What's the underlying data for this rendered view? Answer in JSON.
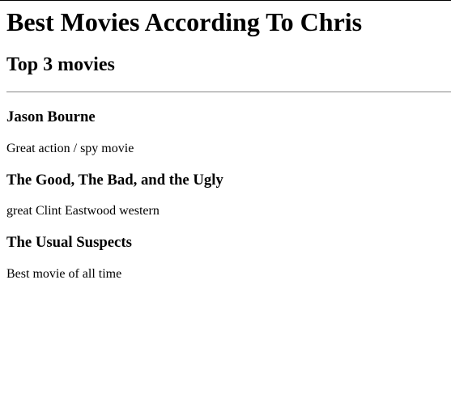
{
  "header": {
    "title": "Best Movies According To Chris",
    "subtitle": "Top 3 movies"
  },
  "movies": [
    {
      "title": "Jason Bourne",
      "description": "Great action / spy movie"
    },
    {
      "title": "The Good, The Bad, and the Ugly",
      "description": "great Clint Eastwood western"
    },
    {
      "title": "The Usual Suspects",
      "description": "Best movie of all time"
    }
  ]
}
